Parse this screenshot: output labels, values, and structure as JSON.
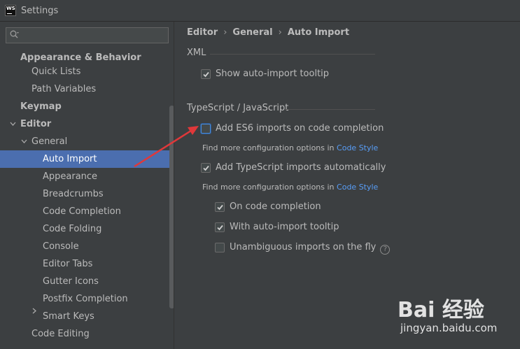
{
  "window": {
    "title": "Settings",
    "logo_text": "WS"
  },
  "search": {
    "placeholder": ""
  },
  "sidebar": {
    "items": [
      {
        "label": "Appearance & Behavior",
        "bold": true
      },
      {
        "label": "Quick Lists"
      },
      {
        "label": "Path Variables"
      },
      {
        "label": "Keymap",
        "bold": true
      },
      {
        "label": "Editor",
        "bold": true,
        "expanded": true
      },
      {
        "label": "General",
        "expanded": true
      },
      {
        "label": "Auto Import",
        "selected": true
      },
      {
        "label": "Appearance"
      },
      {
        "label": "Breadcrumbs"
      },
      {
        "label": "Code Completion"
      },
      {
        "label": "Code Folding"
      },
      {
        "label": "Console"
      },
      {
        "label": "Editor Tabs"
      },
      {
        "label": "Gutter Icons"
      },
      {
        "label": "Postfix Completion"
      },
      {
        "label": "Smart Keys",
        "collapsed": true
      },
      {
        "label": "Code Editing"
      }
    ]
  },
  "breadcrumb": {
    "part1": "Editor",
    "part2": "General",
    "part3": "Auto Import",
    "separator": "›"
  },
  "sections": {
    "xml": {
      "title": "XML",
      "show_tooltip": {
        "label": "Show auto-import tooltip",
        "checked": true
      }
    },
    "ts": {
      "title": "TypeScript / JavaScript",
      "es6_imports": {
        "label": "Add ES6 imports on code completion",
        "checked": false
      },
      "hint1": {
        "text": "Find more configuration options in",
        "link": "Code Style"
      },
      "ts_auto": {
        "label": "Add TypeScript imports automatically",
        "checked": true
      },
      "hint2": {
        "text": "Find more configuration options in",
        "link": "Code Style"
      },
      "on_completion": {
        "label": "On code completion",
        "checked": true
      },
      "with_tooltip": {
        "label": "With auto-import tooltip",
        "checked": true
      },
      "unambiguous": {
        "label": "Unambiguous imports on the fly",
        "checked": false,
        "help": "?"
      }
    }
  },
  "watermark": {
    "line1": "Bai 经验",
    "line2": "jingyan.baidu.com"
  },
  "colors": {
    "selection": "#4b6eaf",
    "link": "#589df6",
    "annotation": "#e0383a"
  }
}
